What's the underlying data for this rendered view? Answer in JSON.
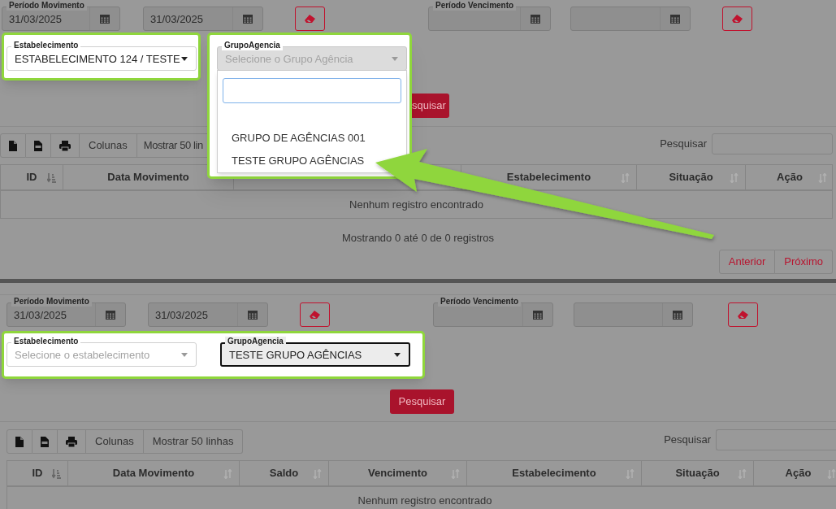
{
  "panels": [
    {
      "kind": "each_field",
      "periodo_movimento": {
        "label": "Período Movimento",
        "start": "31/03/2025",
        "end": "31/03/2025"
      },
      "periodo_vencimento": {
        "label": "Período Vencimento"
      },
      "estabelecimento": {
        "label": "Estabelecimento",
        "value": "ESTABELECIMENTO 124 / TESTE"
      },
      "grupo_agencia": {
        "label": "GrupoAgencia",
        "placeholder": "Selecione o Grupo Agência",
        "expanded": true,
        "focused": false,
        "options": [
          {
            "label": "GRUPO DE AGÊNCIAS 001"
          },
          {
            "label": "TESTE GRUPO AGÊNCIAS"
          }
        ]
      },
      "search_button": "squisar",
      "toolbar": [
        "Colunas",
        "Mostrar 50 lin"
      ],
      "table_search_label": "Pesquisar",
      "columns": [
        {
          "label": "ID",
          "sorted": true
        },
        {
          "label": "Data Movimento"
        },
        {
          "label": "Estabelecimento",
          "sorted": false
        },
        {
          "label": "Situação",
          "sorted": false
        },
        {
          "label": "Ação",
          "sorted": false
        }
      ],
      "empty_message": "Nenhum registro encontrado",
      "info": "Mostrando 0 até 0 de 0 registros",
      "pagination": [
        "Anterior",
        "Próximo"
      ]
    },
    {
      "kind": "filter_row",
      "periodo_movimento": {
        "label": "Período Movimento",
        "start": "31/03/2025",
        "end": "31/03/2025"
      },
      "periodo_vencimento": {
        "label": "Período Vencimento"
      },
      "estabelecimento": {
        "label": "Estabelecimento",
        "placeholder": "Selecione o estabelecimento"
      },
      "grupo_agencia": {
        "label": "GrupoAgencia",
        "value": "TESTE GRUPO AGÊNCIAS",
        "focused": true
      },
      "search_button": "Pesquisar",
      "toolbar": [
        "Colunas",
        "Mostrar 50 linhas"
      ],
      "table_search_label": "Pesquisar",
      "columns": [
        {
          "label": "ID",
          "sorted": true
        },
        {
          "label": "Data Movimento",
          "sorted": false
        },
        {
          "label": "Saldo",
          "sorted": false
        },
        {
          "label": "Vencimento",
          "sorted": false
        },
        {
          "label": "Estabelecimento",
          "sorted": false
        },
        {
          "label": "Situação",
          "sorted": false
        },
        {
          "label": "Ação",
          "sorted": false
        }
      ],
      "empty_message": "Nenhum registro encontrado"
    }
  ]
}
